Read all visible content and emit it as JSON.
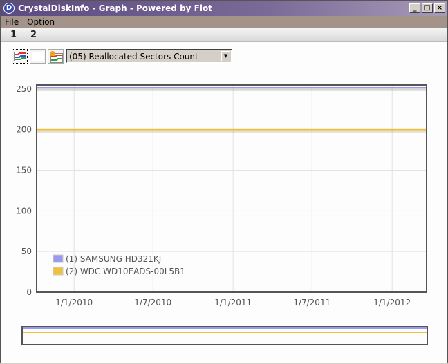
{
  "window": {
    "title": "CrystalDiskInfo - Graph - Powered by Flot",
    "app_icon_letter": "D",
    "minimize": "_",
    "maximize": "□",
    "close": "×"
  },
  "menu": {
    "file": "File",
    "option": "Option"
  },
  "tabs": [
    "1",
    "2"
  ],
  "toolbar": {
    "attribute_select": "(05) Reallocated Sectors Count"
  },
  "chart_data": {
    "type": "line",
    "title": "",
    "ylim": [
      0,
      255
    ],
    "yticks": [
      0,
      50,
      100,
      150,
      200,
      250
    ],
    "xlim": [
      "2009-10-07",
      "2012-03-20"
    ],
    "xticks": [
      {
        "date": "2010-01-01",
        "label": "1/1/2010"
      },
      {
        "date": "2010-07-01",
        "label": "1/7/2010"
      },
      {
        "date": "2011-01-01",
        "label": "1/1/2011"
      },
      {
        "date": "2011-07-01",
        "label": "1/7/2011"
      },
      {
        "date": "2012-01-01",
        "label": "1/1/2012"
      }
    ],
    "grid": true,
    "legend_position": "bottom-left",
    "series": [
      {
        "name": "(1) SAMSUNG HD321KJ",
        "color": "#9a9af0",
        "value": 253
      },
      {
        "name": "(2) WDC WD10EADS-00L5B1",
        "color": "#edc240",
        "value": 200
      }
    ]
  }
}
